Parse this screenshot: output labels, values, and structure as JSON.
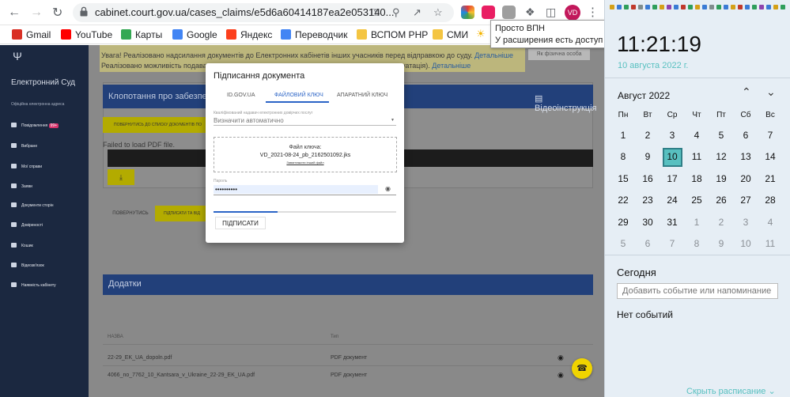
{
  "browser": {
    "url": "cabinet.court.gov.ua/cases_claims/e5d6a60414187ea2e053140...",
    "avatar": "VD",
    "bookmarks": [
      {
        "label": "Gmail",
        "color": "#d93025"
      },
      {
        "label": "YouTube",
        "color": "#ff0000"
      },
      {
        "label": "Карты",
        "color": "#34a853"
      },
      {
        "label": "Google",
        "color": "#4285f4"
      },
      {
        "label": "Яндекс",
        "color": "#fc3f1d"
      },
      {
        "label": "Переводчик",
        "color": "#4285f4"
      },
      {
        "label": "ВСПОМ РНР",
        "color": "#f4c542"
      },
      {
        "label": "СМИ",
        "color": "#f4c542"
      }
    ],
    "tooltip": {
      "line1": "Просто ВПН",
      "line2": "У расширения есть доступ к"
    }
  },
  "sidebar": {
    "title": "Електронний Суд",
    "subtitle": "Офіційна електронна адреса",
    "items": [
      {
        "label": "Повідомлення",
        "badge": "99+"
      },
      {
        "label": "Вибране"
      },
      {
        "label": "Мої справи"
      },
      {
        "label": "Заяви"
      },
      {
        "label": "Документи сторін"
      },
      {
        "label": "Довіреності"
      },
      {
        "label": "Кошик"
      },
      {
        "label": "Відеозв'язок"
      },
      {
        "label": "Наявність кабінету"
      }
    ]
  },
  "main": {
    "notice_line1": "Увага! Реалізовано надсилання документів до Електронних кабінетів інших учасників перед відправкою до суду.",
    "notice_line1_link": "Детальніше",
    "notice_line2": "Реалізовано можливість подавати",
    "notice_line2_tail": "уатація).",
    "notice_line2_link": "Детальніше",
    "person_type": "Як фізична особа",
    "card1_title": "Клопотання про забезпечен",
    "video_link": "Відеоінструкція",
    "back_to_list": "ПОВЕРНУТИСЬ ДО СПИСКУ ДОКУМЕНТІВ ПО",
    "pdf_fail": "Failed to load PDF file.",
    "btn_back": "ПОВЕРНУТИСЬ",
    "btn_sign_send": "ПІДПИСАТИ ТА ВІД",
    "attachments_title": "Додатки",
    "col_name": "НАЗВА",
    "col_type": "Тип",
    "files": [
      {
        "name": "22-29_EK_UA_dopoln.pdf",
        "type": "PDF документ"
      },
      {
        "name": "4066_no_7762_10_Kantsara_v_Ukraine_22-29_EK_UA.pdf",
        "type": "PDF документ"
      }
    ]
  },
  "modal": {
    "title": "Підписання документа",
    "tabs": [
      "ID.GOV.UA",
      "ФАЙЛОВИЙ КЛЮЧ",
      "АПАРАТНИЙ КЛЮЧ"
    ],
    "active_tab": 1,
    "provider_label": "Кваліфікований надавач електронних довірчих послуг",
    "provider_value": "Визначити автоматично",
    "key_label": "Файл ключа:",
    "key_file": "VD_2021-08-24_pb_2162501092.jks",
    "upload_other": "Завантажити інший файл",
    "password_label": "Пароль",
    "password_value": "••••••••••",
    "progress": 0.35,
    "sign_button": "ПІДПИСАТИ"
  },
  "calendar": {
    "time": "11:21:19",
    "date": "10 августа 2022 г.",
    "month": "Август 2022",
    "weekdays": [
      "Пн",
      "Вт",
      "Ср",
      "Чт",
      "Пт",
      "Сб",
      "Вс"
    ],
    "weeks": [
      [
        "1",
        "2",
        "3",
        "4",
        "5",
        "6",
        "7"
      ],
      [
        "8",
        "9",
        "10",
        "11",
        "12",
        "13",
        "14"
      ],
      [
        "15",
        "16",
        "17",
        "18",
        "19",
        "20",
        "21"
      ],
      [
        "22",
        "23",
        "24",
        "25",
        "26",
        "27",
        "28"
      ],
      [
        "29",
        "30",
        "31",
        "1",
        "2",
        "3",
        "4"
      ],
      [
        "5",
        "6",
        "7",
        "8",
        "9",
        "10",
        "11"
      ]
    ],
    "today_label": "Сегодня",
    "event_placeholder": "Добавить событие или напоминание",
    "no_events": "Нет событий",
    "hide_schedule": "Скрыть расписание",
    "accent": "#58c0c0"
  }
}
